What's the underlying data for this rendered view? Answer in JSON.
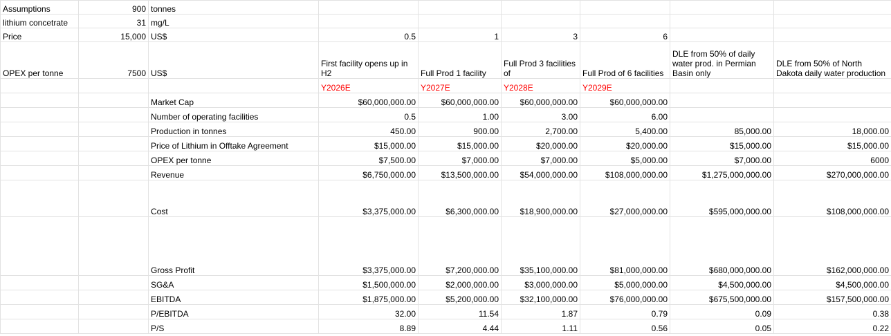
{
  "assumptions": [
    {
      "label": "Assumptions",
      "value": "900",
      "unit": "tonnes"
    },
    {
      "label": "lithium concetrate",
      "value": "31",
      "unit": "mg/L"
    },
    {
      "label": "Price",
      "value": "15,000",
      "unit": "US$"
    },
    {
      "label": "OPEX per tonne",
      "value": "7500",
      "unit": "US$"
    }
  ],
  "facility_multipliers": [
    "0.5",
    "1",
    "3",
    "6"
  ],
  "column_headers": [
    "First facility opens up in H2",
    "Full Prod 1 facility",
    "Full Prod 3 facilities of",
    "Full Prod of 6 facilities",
    "DLE from 50% of daily water prod. in Permian Basin only",
    "DLE from 50% of North Dakota daily water production"
  ],
  "years": [
    "Y2026E",
    "Y2027E",
    "Y2028E",
    "Y2029E"
  ],
  "rows": [
    {
      "label": "Market Cap",
      "values": [
        "$60,000,000.00",
        "$60,000,000.00",
        "$60,000,000.00",
        "$60,000,000.00",
        "",
        ""
      ]
    },
    {
      "label": "Number of operating facilities",
      "values": [
        "0.5",
        "1.00",
        "3.00",
        "6.00",
        "",
        ""
      ]
    },
    {
      "label": "Production in tonnes",
      "values": [
        "450.00",
        "900.00",
        "2,700.00",
        "5,400.00",
        "85,000.00",
        "18,000.00"
      ]
    },
    {
      "label": "Price of Lithium in Offtake Agreement",
      "values": [
        "$15,000.00",
        "$15,000.00",
        "$20,000.00",
        "$20,000.00",
        "$15,000.00",
        "$15,000.00"
      ]
    },
    {
      "label": "OPEX per tonne",
      "values": [
        "$7,500.00",
        "$7,000.00",
        "$7,000.00",
        "$5,000.00",
        "$7,000.00",
        "6000"
      ]
    },
    {
      "label": "Revenue",
      "values": [
        "$6,750,000.00",
        "$13,500,000.00",
        "$54,000,000.00",
        "$108,000,000.00",
        "$1,275,000,000.00",
        "$270,000,000.00"
      ]
    },
    {
      "label": "Cost",
      "values": [
        "$3,375,000.00",
        "$6,300,000.00",
        "$18,900,000.00",
        "$27,000,000.00",
        "$595,000,000.00",
        "$108,000,000.00"
      ]
    },
    {
      "label": "Gross Profit",
      "values": [
        "$3,375,000.00",
        "$7,200,000.00",
        "$35,100,000.00",
        "$81,000,000.00",
        "$680,000,000.00",
        "$162,000,000.00"
      ]
    },
    {
      "label": "SG&A",
      "values": [
        "$1,500,000.00",
        "$2,000,000.00",
        "$3,000,000.00",
        "$5,000,000.00",
        "$4,500,000.00",
        "$4,500,000.00"
      ]
    },
    {
      "label": "EBITDA",
      "values": [
        "$1,875,000.00",
        "$5,200,000.00",
        "$32,100,000.00",
        "$76,000,000.00",
        "$675,500,000.00",
        "$157,500,000.00"
      ]
    },
    {
      "label": "P/EBITDA",
      "values": [
        "32.00",
        "11.54",
        "1.87",
        "0.79",
        "0.09",
        "0.38"
      ]
    },
    {
      "label": "P/S",
      "values": [
        "8.89",
        "4.44",
        "1.11",
        "0.56",
        "0.05",
        "0.22"
      ]
    }
  ]
}
